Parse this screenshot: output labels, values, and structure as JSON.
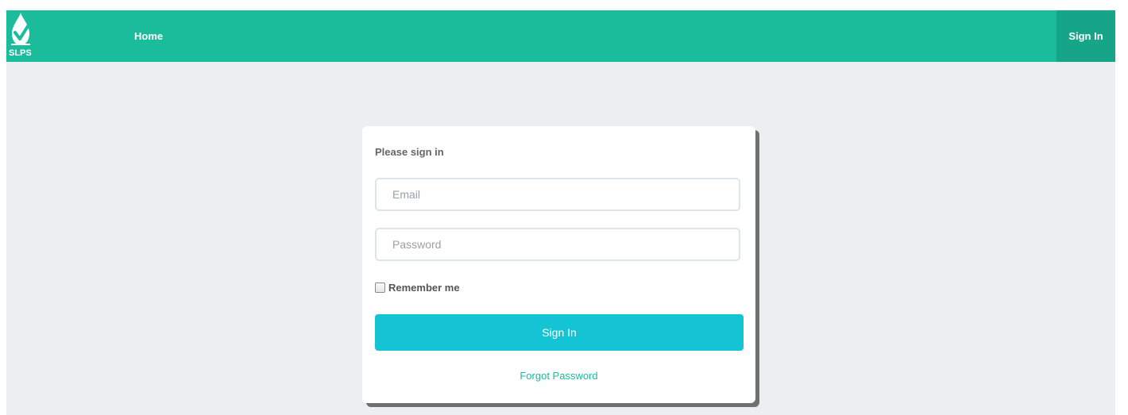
{
  "brand": {
    "name": "SLPS",
    "icon": "water-drop-check-icon"
  },
  "nav": {
    "home_label": "Home",
    "signin_label": "Sign In"
  },
  "login": {
    "heading": "Please sign in",
    "email_placeholder": "Email",
    "email_value": "",
    "password_placeholder": "Password",
    "password_value": "",
    "remember_label": "Remember me",
    "remember_checked": false,
    "submit_label": "Sign In",
    "forgot_label": "Forgot Password"
  },
  "colors": {
    "navbar": "#1abc9c",
    "navbar_active": "#17a589",
    "page_background": "#ebeff0",
    "button": "#14c3d4",
    "link": "#18bc9c"
  }
}
